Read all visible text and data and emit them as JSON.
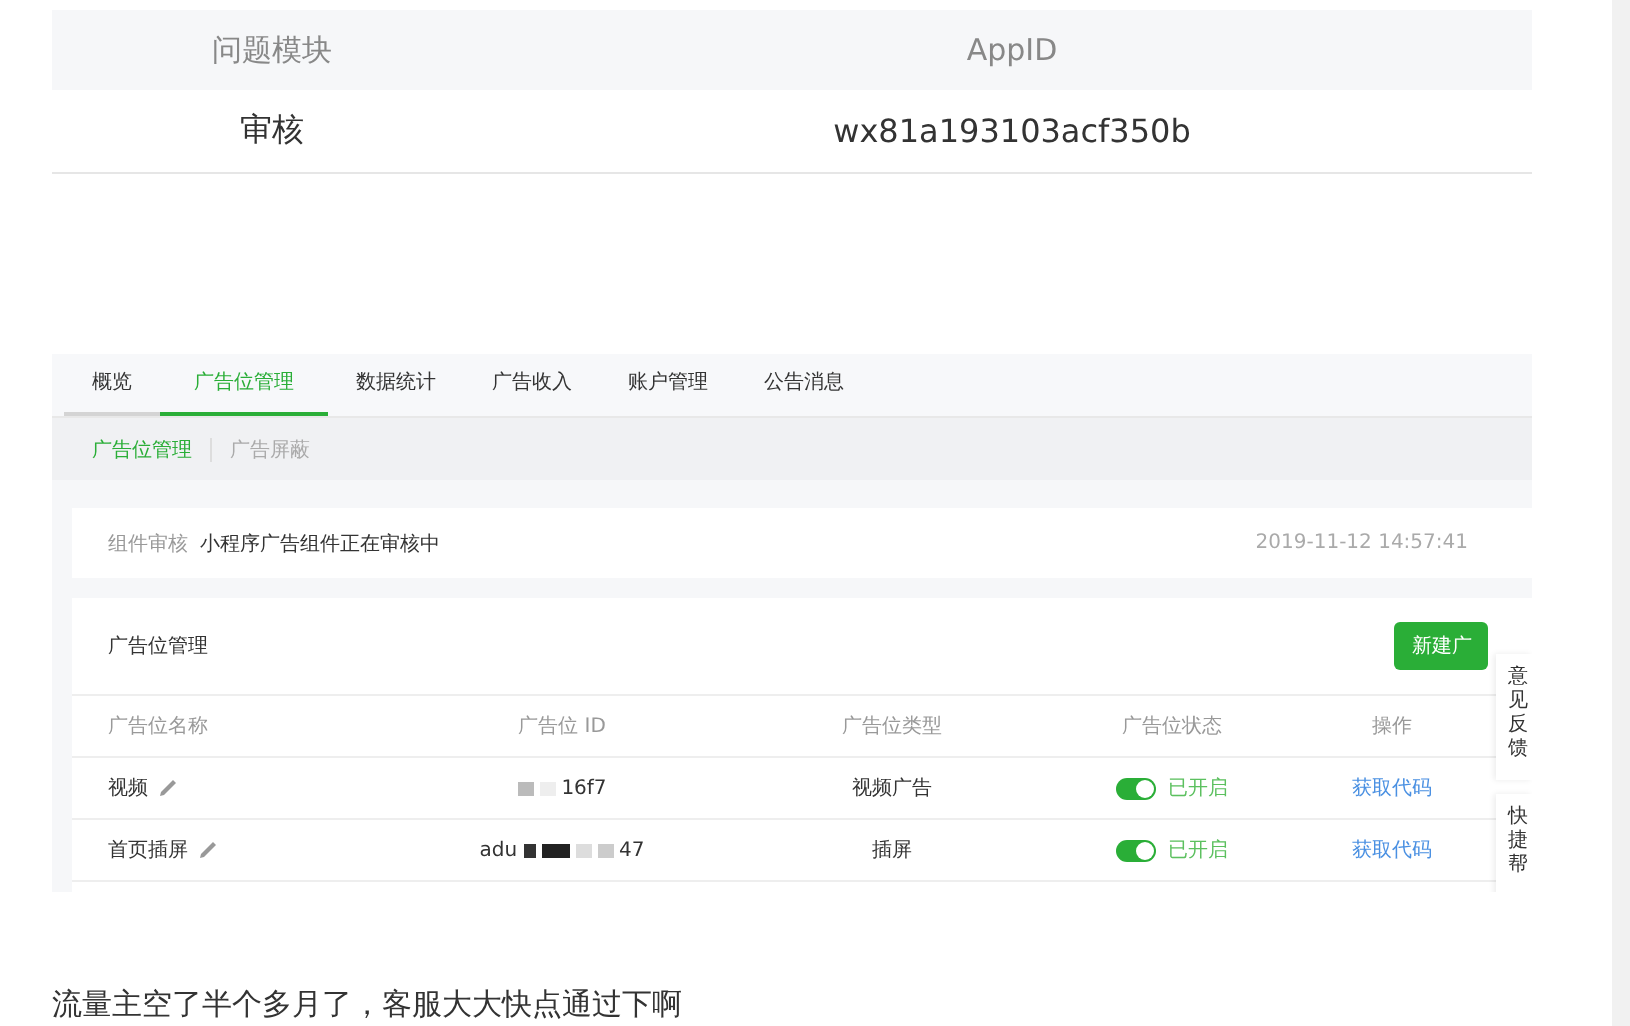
{
  "info_table": {
    "columns": [
      "问题模块",
      "AppID"
    ],
    "rows": [
      [
        "审核",
        "wx81a193103acf350b"
      ]
    ]
  },
  "screenshot": {
    "tabs": [
      {
        "label": "概览",
        "selected": false
      },
      {
        "label": "广告位管理",
        "selected": true
      },
      {
        "label": "数据统计",
        "selected": false
      },
      {
        "label": "广告收入",
        "selected": false
      },
      {
        "label": "账户管理",
        "selected": false
      },
      {
        "label": "公告消息",
        "selected": false
      }
    ],
    "subtabs": [
      {
        "label": "广告位管理",
        "selected": true
      },
      {
        "label": "广告屏蔽",
        "selected": false
      }
    ],
    "notice": {
      "label": "组件审核",
      "message": "小程序广告组件正在审核中",
      "time": "2019-11-12 14:57:41"
    },
    "panel": {
      "title": "广告位管理",
      "button": "新建广",
      "columns": [
        "广告位名称",
        "广告位 ID",
        "广告位类型",
        "广告位状态",
        "操作"
      ],
      "rows": [
        {
          "name": "视频",
          "id_prefix": "",
          "id_suffix": "16f7",
          "type": "视频广告",
          "on": true,
          "status": "已开启",
          "action": "获取代码"
        },
        {
          "name": "首页插屏",
          "id_prefix": "adu",
          "id_suffix": "47",
          "type": "插屏",
          "on": true,
          "status": "已开启",
          "action": "获取代码"
        }
      ]
    },
    "side_buttons": [
      "意见反馈",
      "快捷帮"
    ]
  },
  "comment": "流量主空了半个多月了，客服大大快点通过下啊"
}
